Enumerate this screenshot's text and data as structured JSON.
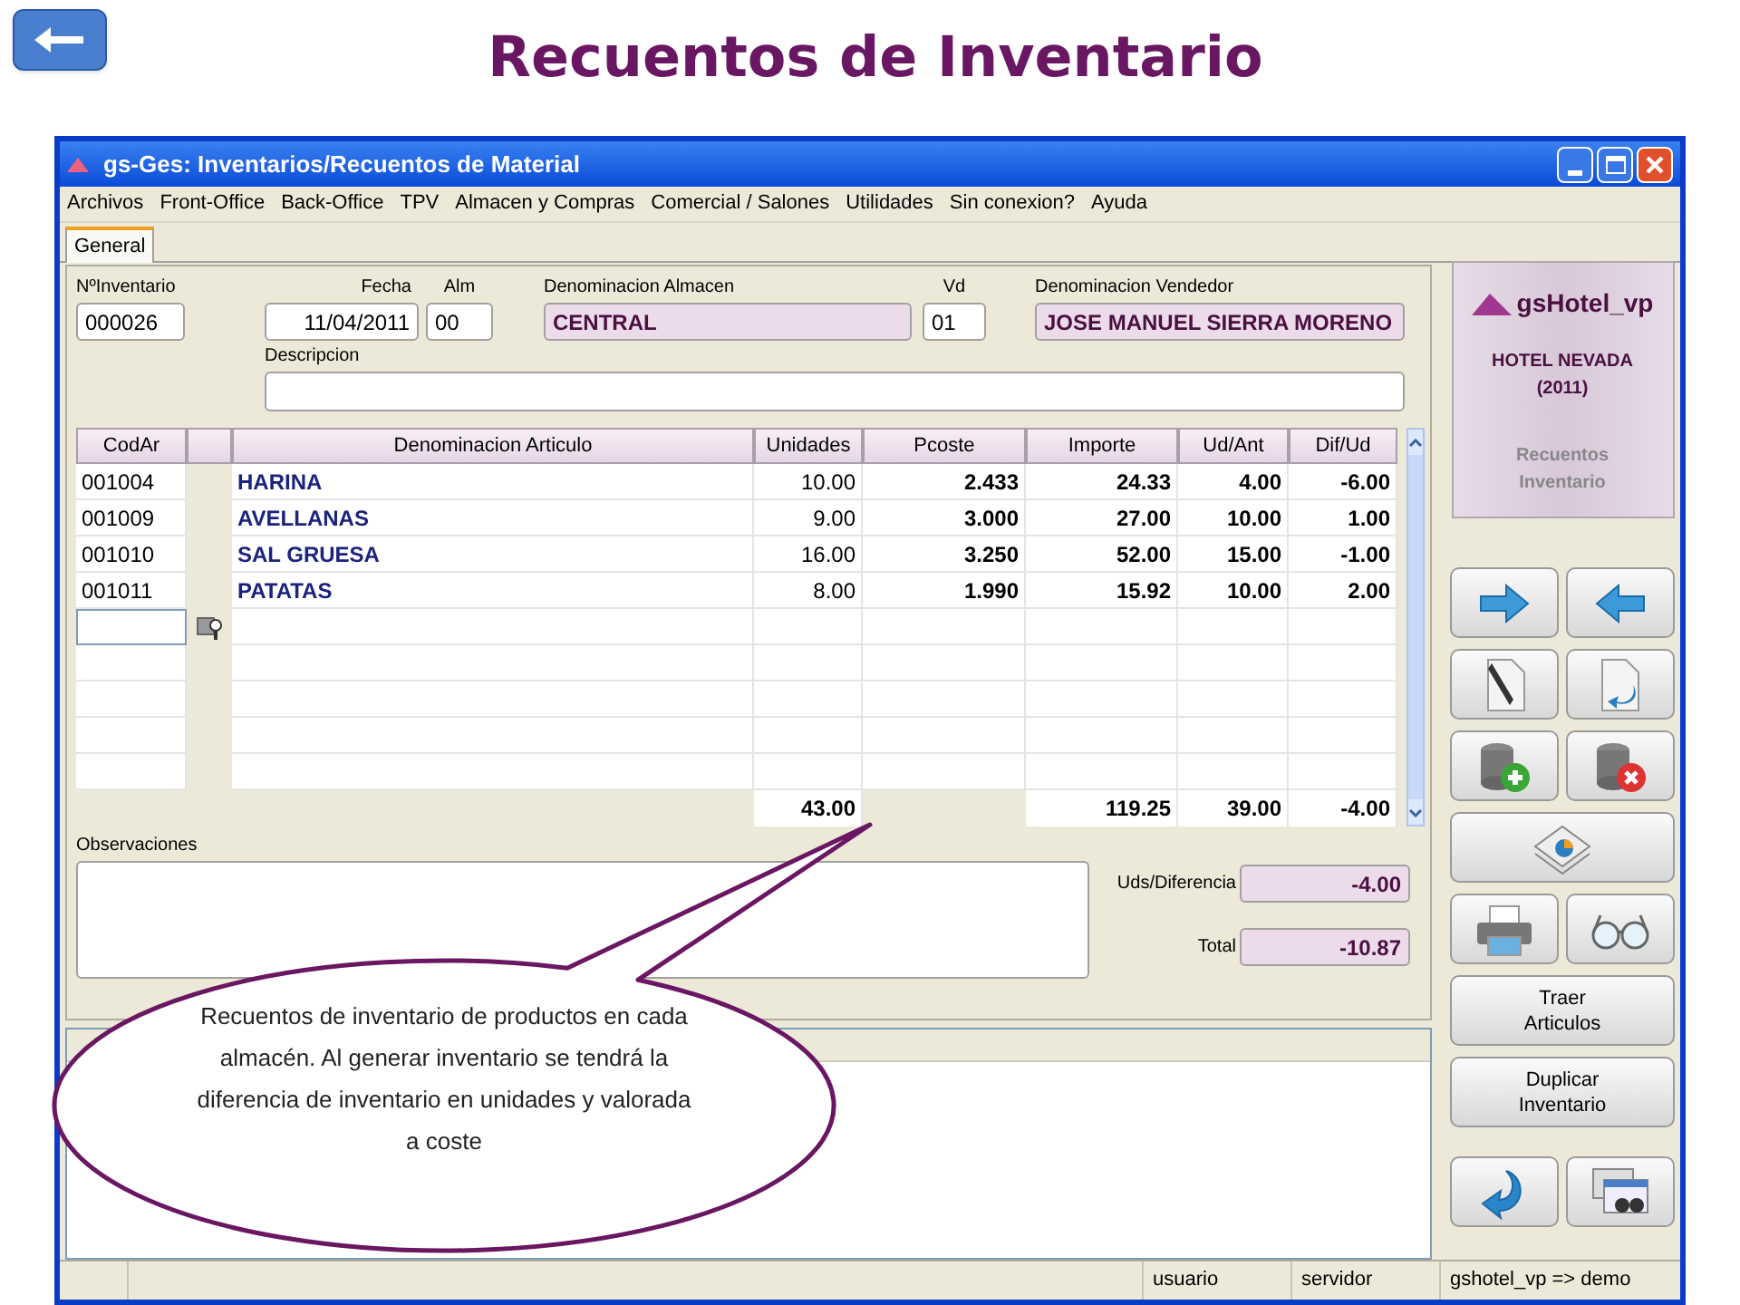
{
  "slide_title": "Recuentos de Inventario",
  "window": {
    "title": "gs-Ges: Inventarios/Recuentos de Material"
  },
  "menu": [
    "Archivos",
    "Front-Office",
    "Back-Office",
    "TPV",
    "Almacen y Compras",
    "Comercial / Salones",
    "Utilidades",
    "Sin conexion?",
    "Ayuda"
  ],
  "tabs": [
    {
      "label": "General",
      "selected": true
    }
  ],
  "header_fields": [
    {
      "label": "NºInventario",
      "value": "000026",
      "kind": "plain"
    },
    {
      "label": "Fecha",
      "value": "11/04/2011",
      "kind": "date"
    },
    {
      "label": "Alm",
      "value": "00",
      "kind": "plain"
    },
    {
      "label": "Denominacion Almacen",
      "value": "CENTRAL",
      "kind": "readonly"
    },
    {
      "label": "Vd",
      "value": "01",
      "kind": "plain"
    },
    {
      "label": "Denominacion Vendedor",
      "value": "JOSE MANUEL SIERRA MORENO",
      "kind": "readonly"
    }
  ],
  "description": {
    "label": "Descripcion"
  },
  "table": {
    "columns": [
      "CodAr",
      "",
      "Denominacion Articulo",
      "Unidades",
      "Pcoste",
      "Importe",
      "Ud/Ant",
      "Dif/Ud"
    ],
    "rows": [
      {
        "codar": "001004",
        "name": "HARINA",
        "unidades": "10.00",
        "pcoste": "2.433",
        "importe": "24.33",
        "ud_ant": "4.00",
        "dif_ud": "-6.00"
      },
      {
        "codar": "001009",
        "name": "AVELLANAS",
        "unidades": "9.00",
        "pcoste": "3.000",
        "importe": "27.00",
        "ud_ant": "10.00",
        "dif_ud": "1.00"
      },
      {
        "codar": "001010",
        "name": "SAL GRUESA",
        "unidades": "16.00",
        "pcoste": "3.250",
        "importe": "52.00",
        "ud_ant": "15.00",
        "dif_ud": "-1.00"
      },
      {
        "codar": "001011",
        "name": "PATATAS",
        "unidades": "8.00",
        "pcoste": "1.990",
        "importe": "15.92",
        "ud_ant": "10.00",
        "dif_ud": "2.00"
      }
    ],
    "totals": {
      "unidades": "43.00",
      "importe": "119.25",
      "ud_ant": "39.00",
      "dif_ud": "-4.00"
    }
  },
  "observations": {
    "label": "Observaciones"
  },
  "summary": [
    {
      "label": "Uds/Diferencia",
      "value": "-4.00"
    },
    {
      "label": "Total",
      "value": "-10.87"
    }
  ],
  "logo_panel": {
    "brand": "gsHotel_vp",
    "hotel": "HOTEL NEVADA",
    "year": "(2011)",
    "module_lines": [
      "Recuentos",
      "Inventario"
    ]
  },
  "action_buttons": [
    {
      "label": "Traer\nArticulos"
    },
    {
      "label": "Duplicar\nInventario"
    }
  ],
  "callout": {
    "text": "Recuentos de inventario de productos en cada almacén. Al generar inventario se tendrá la diferencia de inventario en unidades y valorada a coste"
  },
  "status_bar": [
    "usuario",
    "servidor",
    "gshotel_vp => demo"
  ]
}
